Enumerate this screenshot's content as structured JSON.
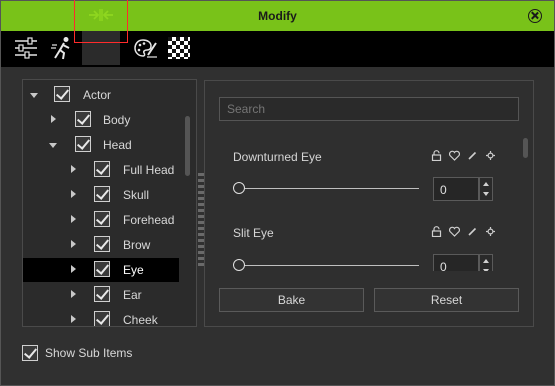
{
  "window": {
    "title": "Modify"
  },
  "toolbar": {
    "tools": [
      {
        "icon": "sliders-icon",
        "label": ""
      },
      {
        "icon": "motion-icon",
        "label": ""
      },
      {
        "icon": "morph-icon",
        "label": "",
        "active": true
      },
      {
        "icon": "palette-icon",
        "label": ""
      },
      {
        "icon": "checkerboard-icon",
        "label": ""
      }
    ],
    "accent": "#79c219",
    "highlight": "#ff2b2b"
  },
  "tree": {
    "items": [
      {
        "label": "Actor",
        "expanded": true,
        "checked": true
      },
      {
        "label": "Body",
        "expanded": false,
        "checked": true
      },
      {
        "label": "Head",
        "expanded": true,
        "checked": true
      },
      {
        "label": "Full Head",
        "expanded": false,
        "checked": true
      },
      {
        "label": "Skull",
        "expanded": false,
        "checked": true
      },
      {
        "label": "Forehead",
        "expanded": false,
        "checked": true
      },
      {
        "label": "Brow",
        "expanded": false,
        "checked": true
      },
      {
        "label": "Eye",
        "expanded": false,
        "checked": true,
        "selected": true
      },
      {
        "label": "Ear",
        "expanded": false,
        "checked": true
      },
      {
        "label": "Cheek",
        "expanded": false,
        "checked": true
      }
    ]
  },
  "search": {
    "placeholder": "Search"
  },
  "morphs": [
    {
      "name": "Downturned Eye",
      "value": "0"
    },
    {
      "name": "Slit Eye",
      "value": "0"
    }
  ],
  "buttons": {
    "bake": "Bake",
    "reset": "Reset"
  },
  "footer": {
    "show_sub_items": "Show Sub Items",
    "checked": true
  }
}
